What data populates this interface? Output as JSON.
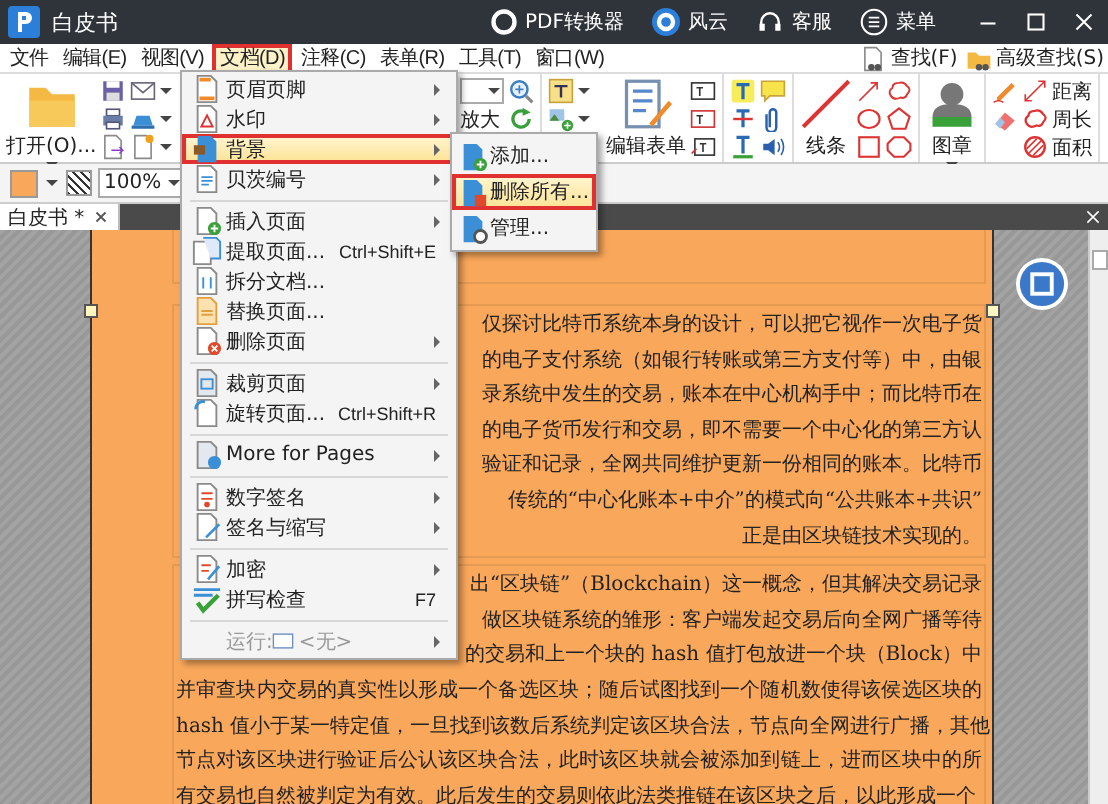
{
  "title_bar": {
    "title": "白皮书",
    "links": [
      {
        "label": "PDF转换器"
      },
      {
        "label": "风云"
      },
      {
        "label": "客服"
      },
      {
        "label": "菜单"
      }
    ]
  },
  "menu_bar": {
    "items": [
      {
        "label": "文件",
        "selected": false
      },
      {
        "label": "编辑(E)",
        "selected": false
      },
      {
        "label": "视图(V)",
        "selected": false
      },
      {
        "label": "文档(D)",
        "selected": true
      },
      {
        "label": "注释(C)",
        "selected": false
      },
      {
        "label": "表单(R)",
        "selected": false
      },
      {
        "label": "工具(T)",
        "selected": false
      },
      {
        "label": "窗口(W)",
        "selected": false
      }
    ],
    "search": [
      {
        "label": "查找(F)"
      },
      {
        "label": "高级查找(S)"
      }
    ]
  },
  "ribbon": {
    "tools": [
      {
        "label": "打开(O)...",
        "dropdown": true
      },
      {
        "label": "放大",
        "dropdown": false
      },
      {
        "label": "编辑表单",
        "dropdown": false
      },
      {
        "label": "线条",
        "dropdown": false
      },
      {
        "label": "图章",
        "dropdown": true
      },
      {
        "label": "距离",
        "dropdown": false
      },
      {
        "label": "周长",
        "dropdown": false
      },
      {
        "label": "面积",
        "dropdown": false
      }
    ]
  },
  "format_bar": {
    "zoom": "100%"
  },
  "document_menu": {
    "items": [
      {
        "kind": "item",
        "label": "页眉页脚",
        "submenu": true,
        "selected": false
      },
      {
        "kind": "item",
        "label": "水印",
        "submenu": true,
        "selected": false
      },
      {
        "kind": "item",
        "label": "背景",
        "submenu": true,
        "selected": true
      },
      {
        "kind": "item",
        "label": "贝茨编号",
        "submenu": true,
        "selected": false
      },
      {
        "kind": "separator"
      },
      {
        "kind": "item",
        "label": "插入页面",
        "submenu": true,
        "selected": false
      },
      {
        "kind": "item",
        "label": "提取页面...",
        "shortcut": "Ctrl+Shift+E",
        "submenu": false,
        "selected": false
      },
      {
        "kind": "item",
        "label": "拆分文档...",
        "submenu": false,
        "selected": false
      },
      {
        "kind": "item",
        "label": "替换页面...",
        "submenu": false,
        "selected": false
      },
      {
        "kind": "item",
        "label": "删除页面",
        "submenu": true,
        "selected": false
      },
      {
        "kind": "separator"
      },
      {
        "kind": "item",
        "label": "裁剪页面",
        "submenu": true,
        "selected": false
      },
      {
        "kind": "item",
        "label": "旋转页面...",
        "shortcut": "Ctrl+Shift+R",
        "submenu": false,
        "selected": false
      },
      {
        "kind": "separator"
      },
      {
        "kind": "item",
        "label": "More for Pages",
        "submenu": true,
        "selected": false
      },
      {
        "kind": "separator"
      },
      {
        "kind": "item",
        "label": "数字签名",
        "submenu": true,
        "selected": false
      },
      {
        "kind": "item",
        "label": "签名与缩写",
        "submenu": true,
        "selected": false
      },
      {
        "kind": "separator"
      },
      {
        "kind": "item",
        "label": "加密",
        "submenu": true,
        "selected": false
      },
      {
        "kind": "item",
        "label": "拼写检查",
        "shortcut": "F7",
        "submenu": false,
        "selected": false
      },
      {
        "kind": "separator"
      },
      {
        "kind": "item",
        "label": "运行:",
        "value": "<无>",
        "submenu": true,
        "disabled": true,
        "selected": false
      }
    ]
  },
  "background_submenu": {
    "items": [
      {
        "label": "添加...",
        "selected": false
      },
      {
        "label": "删除所有...",
        "selected": true
      },
      {
        "label": "管理...",
        "selected": false
      }
    ]
  },
  "tab": {
    "label": "白皮书 *",
    "selected": true
  },
  "document": {
    "paragraphs": [
      {
        "lines": [
          {
            "text": "仅探讨比特币系统本身的设计，可以把它视作一次电子货",
            "partly_hidden": true
          },
          {
            "text": "的电子支付系统（如银行转账或第三方支付等）中，由银",
            "partly_hidden": true
          },
          {
            "text": "录系统中发生的交易，账本在中心机构手中；而比特币在",
            "partly_hidden": true
          },
          {
            "text": "的电子货币发行和交易，即不需要一个中心化的第三方认",
            "partly_hidden": true
          },
          {
            "text": "验证和记录，全网共同维护更新一份相同的账本。比特币",
            "partly_hidden": true
          },
          {
            "text": "传统的“中心化账本+中介”的模式向“公共账本+共识”",
            "partly_hidden": true
          },
          {
            "text": "正是由区块链技术实现的。",
            "partly_hidden": true
          }
        ]
      },
      {
        "lines": [
          {
            "text": "出“区块链”（Blockchain）这一概念，但其解决交易记录",
            "partly_hidden": true
          },
          {
            "text": "做区块链系统的雏形：客户端发起交易后向全网广播等待",
            "partly_hidden": true
          },
          {
            "text": "的交易和上一个块的 hash 值打包放进一个块（Block）中",
            "partly_hidden": true
          },
          {
            "text": "并审查块内交易的真实性以形成一个备选区块；随后试图找到一个随机数使得该侯选区块的",
            "partly_hidden": false
          },
          {
            "text": "hash 值小于某一特定值，一旦找到该数后系统判定该区块合法，节点向全网进行广播，其他",
            "partly_hidden": false
          },
          {
            "text": "节点对该区块进行验证后公认该区块合法，此时该区块就会被添加到链上，进而区块中的所",
            "partly_hidden": false
          },
          {
            "text": "有交易也自然被判定为有效。此后发生的交易则依此法类推链在该区块之后，以此形成一个",
            "partly_hidden": false
          }
        ]
      }
    ]
  }
}
